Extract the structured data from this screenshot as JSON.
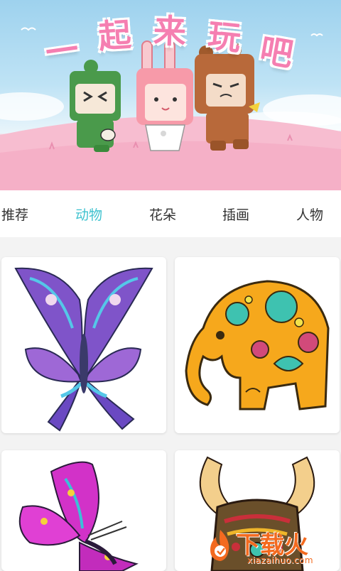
{
  "banner": {
    "title_chars": [
      "一",
      "起",
      "来",
      "玩",
      "吧"
    ]
  },
  "tabs": [
    {
      "label": "推荐",
      "active": false
    },
    {
      "label": "动物",
      "active": true
    },
    {
      "label": "花朵",
      "active": false
    },
    {
      "label": "插画",
      "active": false
    },
    {
      "label": "人物",
      "active": false
    }
  ],
  "gallery": [
    {
      "subject": "butterfly-blue"
    },
    {
      "subject": "elephant"
    },
    {
      "subject": "butterfly-pink"
    },
    {
      "subject": "bull"
    }
  ],
  "watermark": {
    "text": "下载火",
    "url": "xiazaihuo.com"
  },
  "colors": {
    "accent": "#3ec2cf",
    "title_pink": "#f57fb1",
    "watermark_orange": "#f36a1f"
  }
}
